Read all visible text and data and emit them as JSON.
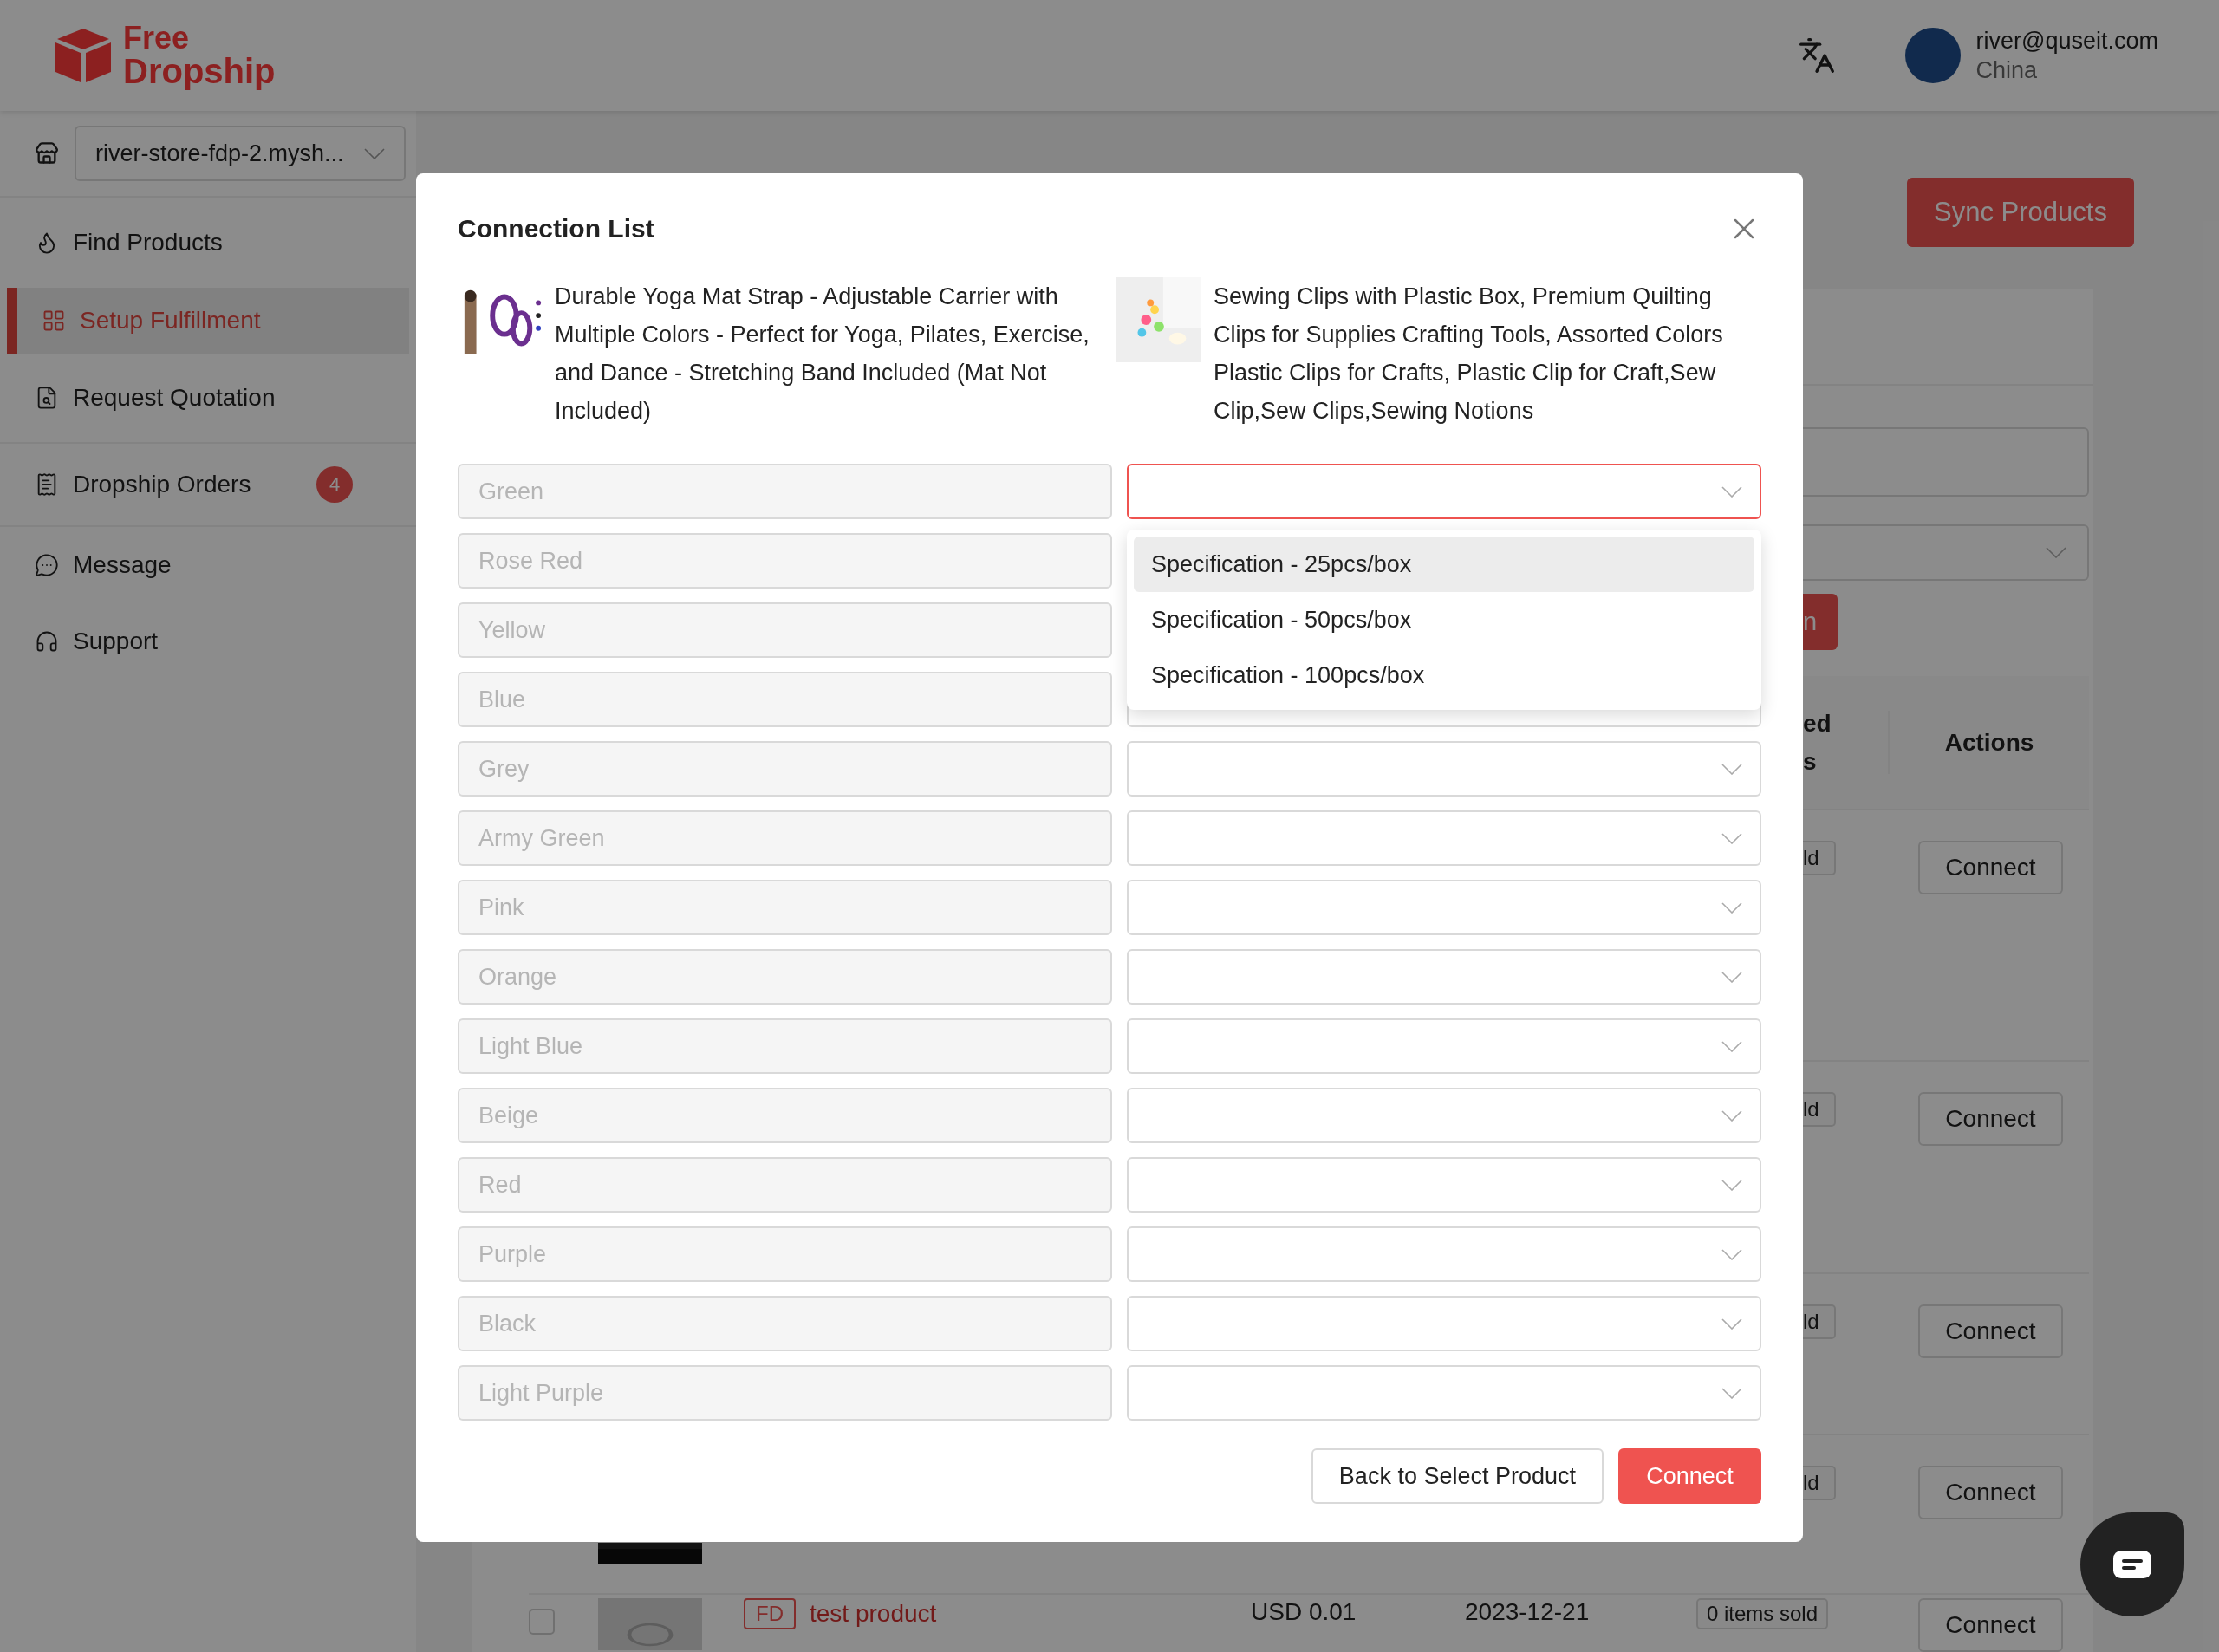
{
  "header": {
    "logo": {
      "line_1": "Free",
      "line_2": "Dropship"
    },
    "account": {
      "email": "river@quseit.com",
      "region": "China"
    }
  },
  "sidebar": {
    "store": "river-store-fdp-2.mysh...",
    "items": [
      {
        "label": "Find Products",
        "selected": false
      },
      {
        "label": "Setup Fulfillment",
        "selected": true
      },
      {
        "label": "Request Quotation",
        "selected": false
      },
      {
        "label": "Dropship Orders",
        "selected": false,
        "badge": "4"
      },
      {
        "label": "Message",
        "selected": false
      },
      {
        "label": "Support",
        "selected": false
      }
    ]
  },
  "main": {
    "sync_button": "Sync Products",
    "filter_button": "n",
    "table": {
      "header_fragment": [
        "ed",
        "s"
      ],
      "actions_header": "Actions",
      "rows": [
        {
          "sold": "ld",
          "action": "Connect"
        },
        {
          "sold": "ld",
          "action": "Connect"
        },
        {
          "sold": "ld",
          "action": "Connect"
        },
        {
          "sold": "ld",
          "action": "Connect"
        }
      ],
      "last_row": {
        "checked": false,
        "tag": "FD",
        "name": "test product",
        "price": "USD 0.01",
        "date": "2023-12-21",
        "sold": "0 items sold",
        "action": "Connect"
      }
    }
  },
  "modal": {
    "title": "Connection List",
    "products": [
      {
        "name": "Durable Yoga Mat Strap - Adjustable Carrier with Multiple Colors - Perfect for Yoga, Pilates, Exercise, and Dance - Stretching Band Included (Mat Not Included)"
      },
      {
        "name": "Sewing Clips with Plastic Box, Premium Quilting Clips for Supplies Crafting Tools, Assorted Colors Plastic Clips for Crafts, Plastic Clip for Craft,Sew Clip,Sew Clips,Sewing Notions"
      }
    ],
    "mappings": [
      {
        "variant": "Green",
        "open": true
      },
      {
        "variant": "Rose Red",
        "open": false
      },
      {
        "variant": "Yellow",
        "open": false
      },
      {
        "variant": "Blue",
        "open": false
      },
      {
        "variant": "Grey",
        "open": false
      },
      {
        "variant": "Army Green",
        "open": false
      },
      {
        "variant": "Pink",
        "open": false
      },
      {
        "variant": "Orange",
        "open": false
      },
      {
        "variant": "Light Blue",
        "open": false
      },
      {
        "variant": "Beige",
        "open": false
      },
      {
        "variant": "Red",
        "open": false
      },
      {
        "variant": "Purple",
        "open": false
      },
      {
        "variant": "Black",
        "open": false
      },
      {
        "variant": "Light Purple",
        "open": false
      }
    ],
    "options": [
      {
        "label": "Specification - 25pcs/box",
        "selected": true
      },
      {
        "label": "Specification - 50pcs/box",
        "selected": false
      },
      {
        "label": "Specification - 100pcs/box",
        "selected": false
      }
    ],
    "back_button": "Back to Select Product",
    "connect_button": "Connect"
  }
}
